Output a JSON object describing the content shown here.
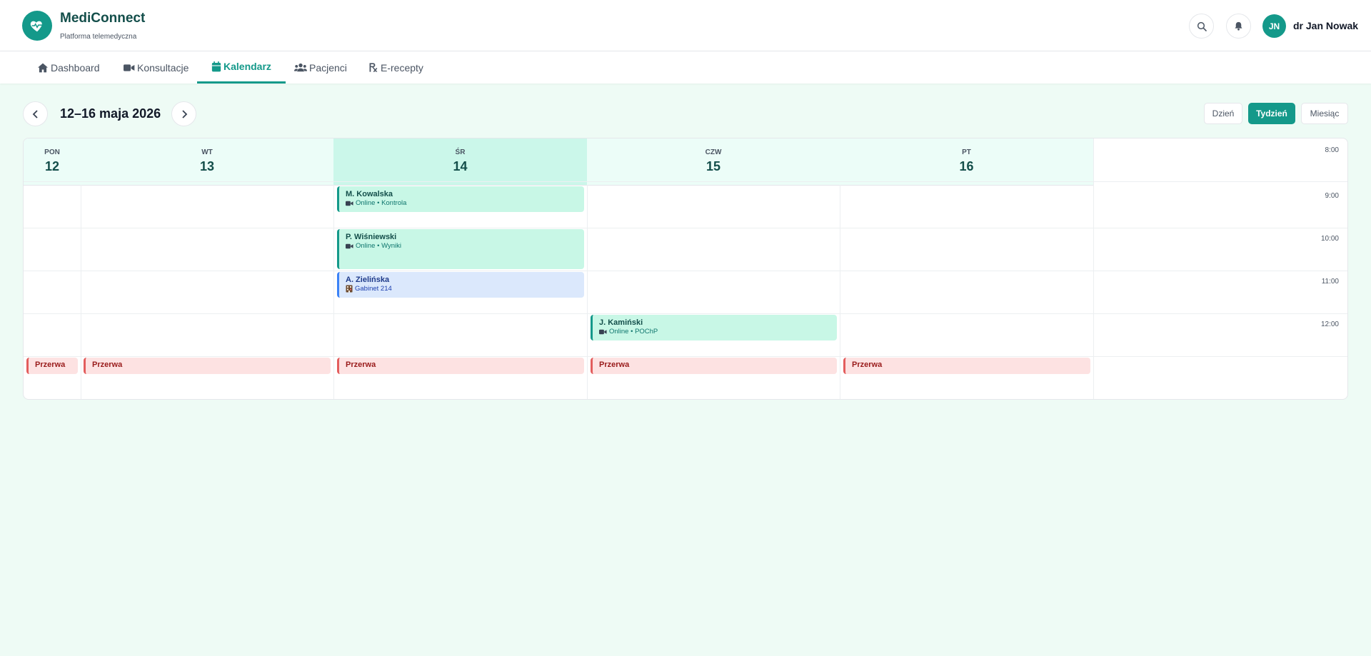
{
  "app": {
    "name": "MediConnect",
    "tagline": "Platforma telemedyczna",
    "brand_color": "#14998a"
  },
  "user": {
    "initials": "JN",
    "name": "dr Jan Nowak"
  },
  "header_icons": [
    "search-icon",
    "bell-icon"
  ],
  "nav": {
    "items": [
      {
        "label": "Dashboard",
        "icon": "home-icon",
        "active": false
      },
      {
        "label": "Konsultacje",
        "icon": "video-icon",
        "active": false
      },
      {
        "label": "Kalendarz",
        "icon": "calendar-icon",
        "active": true
      },
      {
        "label": "Pacjenci",
        "icon": "users-icon",
        "active": false
      },
      {
        "label": "E-recepty",
        "icon": "prescription-icon",
        "active": false
      }
    ]
  },
  "toolbar": {
    "range": "12–16 maja 2026",
    "views": [
      {
        "label": "Dzień",
        "active": false
      },
      {
        "label": "Tydzień",
        "active": true
      },
      {
        "label": "Miesiąc",
        "active": false
      }
    ]
  },
  "calendar": {
    "days": [
      {
        "name": "PON",
        "num": "12",
        "today": false
      },
      {
        "name": "WT",
        "num": "13",
        "today": false
      },
      {
        "name": "ŚR",
        "num": "14",
        "today": true
      },
      {
        "name": "CZW",
        "num": "15",
        "today": false
      },
      {
        "name": "PT",
        "num": "16",
        "today": false
      }
    ],
    "hours": [
      "8:00",
      "9:00",
      "10:00",
      "11:00",
      "12:00"
    ],
    "events": [
      {
        "patient": "M. Kowalska",
        "detail": "Online • Kontrola",
        "kind": "online",
        "icon": "video-icon",
        "day": "ŚR"
      },
      {
        "patient": "P. Wiśniewski",
        "detail": "Online • Wyniki",
        "kind": "online",
        "icon": "video-icon",
        "day": "ŚR"
      },
      {
        "patient": "A. Zielińska",
        "detail": "Gabinet 214",
        "kind": "office",
        "icon": "office-icon",
        "day": "ŚR"
      },
      {
        "patient": "J. Kamiński",
        "detail": "Online • POChP",
        "kind": "online",
        "icon": "video-icon",
        "day": "CZW"
      }
    ],
    "break_label": "Przerwa",
    "colors": {
      "online": "#c8f7e6",
      "office": "#dbe8fc",
      "break": "#fde2e2",
      "today_header": "#cbf7ea"
    }
  }
}
